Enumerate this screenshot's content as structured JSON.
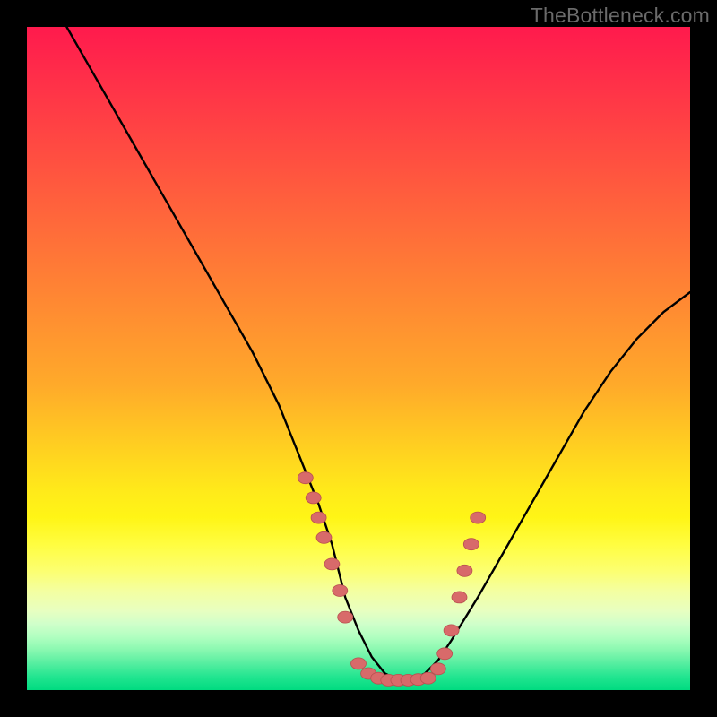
{
  "watermark": "TheBottleneck.com",
  "chart_data": {
    "type": "line",
    "title": "",
    "xlabel": "",
    "ylabel": "",
    "xlim": [
      0,
      100
    ],
    "ylim": [
      0,
      100
    ],
    "grid": false,
    "legend": false,
    "series": [
      {
        "name": "curve",
        "x": [
          6,
          10,
          14,
          18,
          22,
          26,
          30,
          34,
          38,
          42,
          44,
          46,
          48,
          50,
          52,
          54,
          56,
          58,
          60,
          62,
          64,
          68,
          72,
          76,
          80,
          84,
          88,
          92,
          96,
          100
        ],
        "y": [
          100,
          93,
          86,
          79,
          72,
          65,
          58,
          51,
          43,
          33,
          28,
          22,
          14,
          9,
          5,
          2.5,
          1.5,
          1.5,
          2.5,
          4.5,
          7.5,
          14,
          21,
          28,
          35,
          42,
          48,
          53,
          57,
          60
        ]
      }
    ],
    "points": {
      "name": "markers",
      "note": "salmon-colored scatter points near valley of curve",
      "x": [
        42,
        43.2,
        44,
        44.8,
        46,
        47.2,
        48,
        50,
        51.5,
        53,
        54.5,
        56,
        57.5,
        59,
        60.5,
        62,
        63,
        64,
        65.2,
        66,
        67,
        68
      ],
      "y": [
        32,
        29,
        26,
        23,
        19,
        15,
        11,
        4,
        2.5,
        1.8,
        1.5,
        1.5,
        1.5,
        1.6,
        1.8,
        3.2,
        5.5,
        9,
        14,
        18,
        22,
        26
      ]
    }
  }
}
